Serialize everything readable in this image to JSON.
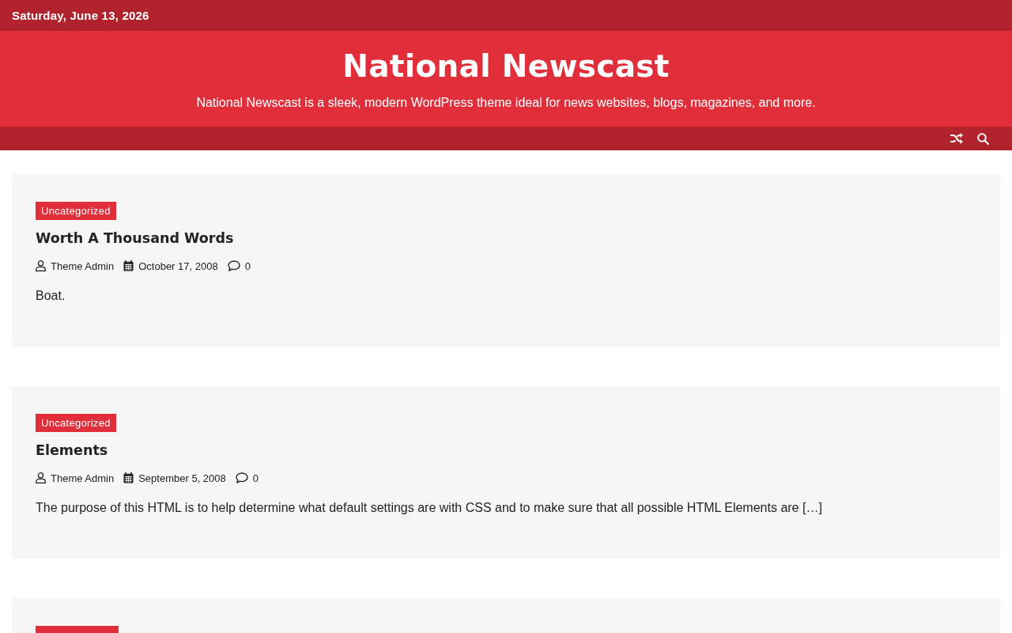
{
  "top_bar": {
    "date": "Saturday, June 13, 2026"
  },
  "header": {
    "site_title": "National Newscast",
    "tagline": "National Newscast is a sleek, modern WordPress theme ideal for news websites, blogs, magazines, and more."
  },
  "posts": [
    {
      "category": "Uncategorized",
      "title": "Worth A Thousand Words",
      "author": "Theme Admin",
      "date": "October 17, 2008",
      "comments": "0",
      "excerpt": "Boat."
    },
    {
      "category": "Uncategorized",
      "title": "Elements",
      "author": "Theme Admin",
      "date": "September 5, 2008",
      "comments": "0",
      "excerpt": "The purpose of this HTML is to help determine what default settings are with CSS and to make sure that all possible HTML Elements are […]"
    }
  ]
}
